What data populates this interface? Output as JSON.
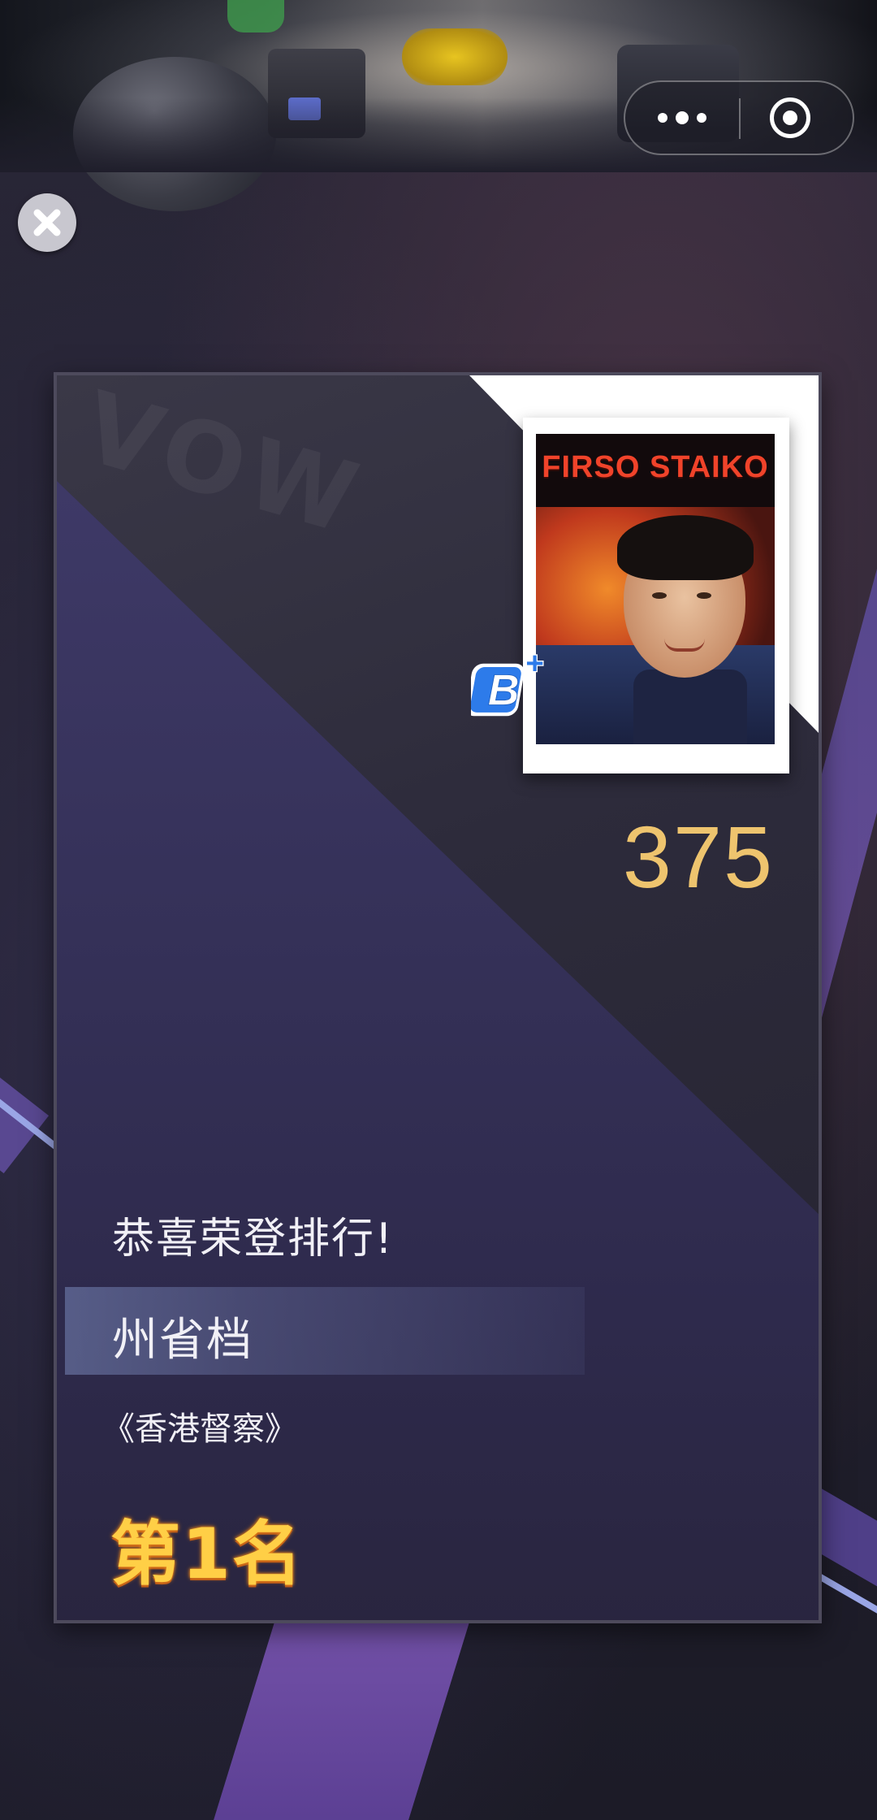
{
  "capsule": {
    "more_icon": "more-dots-icon",
    "close_icon": "target-circle-icon"
  },
  "close_icon": "close-x-icon",
  "card": {
    "watermark": "VOW",
    "poster_title": "FIRSO STAIKO",
    "grade": "B",
    "grade_suffix": "+",
    "score": "375",
    "congrats": "恭喜荣登排行!",
    "tier": "州省档",
    "movie": "《香港督察》",
    "rank": "第1名"
  },
  "colors": {
    "score": "#eec46e",
    "rank": "#ffcf46",
    "grade_badge": "#2d7bea"
  }
}
